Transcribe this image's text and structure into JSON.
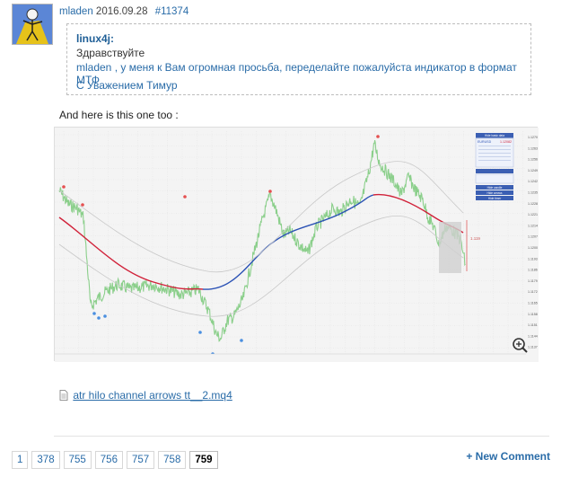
{
  "post": {
    "author": "mladen",
    "date": "2016.09.28",
    "link": "#11374"
  },
  "quote": {
    "author": "linux4j:",
    "greeting": "Здравствуйте",
    "request": "mladen , у меня к Вам огромная просьба, переделайте пожалуйста индикатор в формат МТФ",
    "signature": "С Уважением Тимур"
  },
  "body_text": "And here is this one too :",
  "chart": {
    "panel_buttons": [
      "Hide basic data",
      "Hide candle",
      "Hide arrows",
      "Hide timer"
    ],
    "panel_value_main": "1.12082",
    "price_label": "1.119",
    "tick_prices": [
      "1.1270",
      "1.1263",
      "1.1256",
      "1.1249",
      "1.1242",
      "1.1235",
      "1.1228",
      "1.1221",
      "1.1214",
      "1.1207",
      "1.1200",
      "1.1193",
      "1.1186",
      "1.1179",
      "1.1172",
      "1.1165",
      "1.1158",
      "1.1151",
      "1.1144",
      "1.1137"
    ]
  },
  "attachment": {
    "filename": "atr hilo channel arrows tt__2.mq4"
  },
  "pager": {
    "pages": [
      "1",
      "378",
      "755",
      "756",
      "757",
      "758",
      "759"
    ],
    "current": "759"
  },
  "new_comment": "+ New Comment",
  "icons": {
    "file": "file-icon",
    "zoom": "magnifier-plus-icon"
  }
}
